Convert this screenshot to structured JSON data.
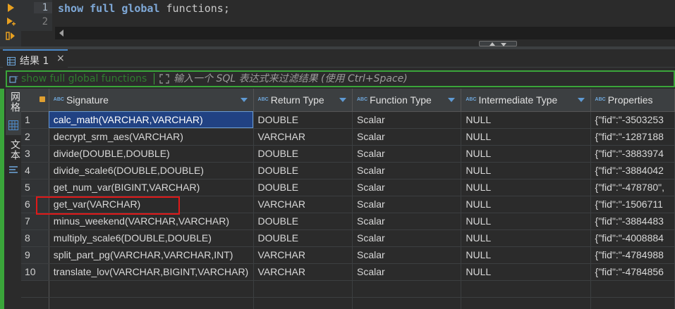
{
  "editor": {
    "line_numbers": [
      "1",
      "2"
    ],
    "code": {
      "kw1": "show",
      "kw2": "full",
      "kw3": "global",
      "ident": "functions",
      "semicolon": ";"
    }
  },
  "toolbar_icons": [
    "run-icon",
    "run-script-icon",
    "explain-icon"
  ],
  "result_tab": {
    "label": "结果 1",
    "close": "×"
  },
  "filter": {
    "query": "show full global functions",
    "placeholder": "输入一个 SQL 表达式来过滤结果 (使用 Ctrl+Space)"
  },
  "vertical_tabs": [
    {
      "label": "网格"
    },
    {
      "label": "文本"
    }
  ],
  "grid": {
    "columns": [
      "Signature",
      "Return Type",
      "Function Type",
      "Intermediate Type",
      "Properties"
    ],
    "rows": [
      {
        "n": "1",
        "sig": "calc_math(VARCHAR,VARCHAR)",
        "ret": "DOUBLE",
        "ftype": "Scalar",
        "itype": "NULL",
        "props": "{\"fid\":\"-3503253"
      },
      {
        "n": "2",
        "sig": "decrypt_srm_aes(VARCHAR)",
        "ret": "VARCHAR",
        "ftype": "Scalar",
        "itype": "NULL",
        "props": "{\"fid\":\"-1287188"
      },
      {
        "n": "3",
        "sig": "divide(DOUBLE,DOUBLE)",
        "ret": "DOUBLE",
        "ftype": "Scalar",
        "itype": "NULL",
        "props": "{\"fid\":\"-3883974"
      },
      {
        "n": "4",
        "sig": "divide_scale6(DOUBLE,DOUBLE)",
        "ret": "DOUBLE",
        "ftype": "Scalar",
        "itype": "NULL",
        "props": "{\"fid\":\"-3884042"
      },
      {
        "n": "5",
        "sig": "get_num_var(BIGINT,VARCHAR)",
        "ret": "DOUBLE",
        "ftype": "Scalar",
        "itype": "NULL",
        "props": "{\"fid\":\"-478780\","
      },
      {
        "n": "6",
        "sig": "get_var(VARCHAR)",
        "ret": "VARCHAR",
        "ftype": "Scalar",
        "itype": "NULL",
        "props": "{\"fid\":\"-1506711"
      },
      {
        "n": "7",
        "sig": "minus_weekend(VARCHAR,VARCHAR)",
        "ret": "DOUBLE",
        "ftype": "Scalar",
        "itype": "NULL",
        "props": "{\"fid\":\"-3884483"
      },
      {
        "n": "8",
        "sig": "multiply_scale6(DOUBLE,DOUBLE)",
        "ret": "DOUBLE",
        "ftype": "Scalar",
        "itype": "NULL",
        "props": "{\"fid\":\"-4008884"
      },
      {
        "n": "9",
        "sig": "split_part_pg(VARCHAR,VARCHAR,INT)",
        "ret": "VARCHAR",
        "ftype": "Scalar",
        "itype": "NULL",
        "props": "{\"fid\":\"-4784988"
      },
      {
        "n": "10",
        "sig": "translate_lov(VARCHAR,BIGINT,VARCHAR)",
        "ret": "VARCHAR",
        "ftype": "Scalar",
        "itype": "NULL",
        "props": "{\"fid\":\"-4784856"
      }
    ]
  },
  "colors": {
    "accent_green": "#3aa53a",
    "selection": "#214283",
    "highlight_box": "#e01919"
  }
}
